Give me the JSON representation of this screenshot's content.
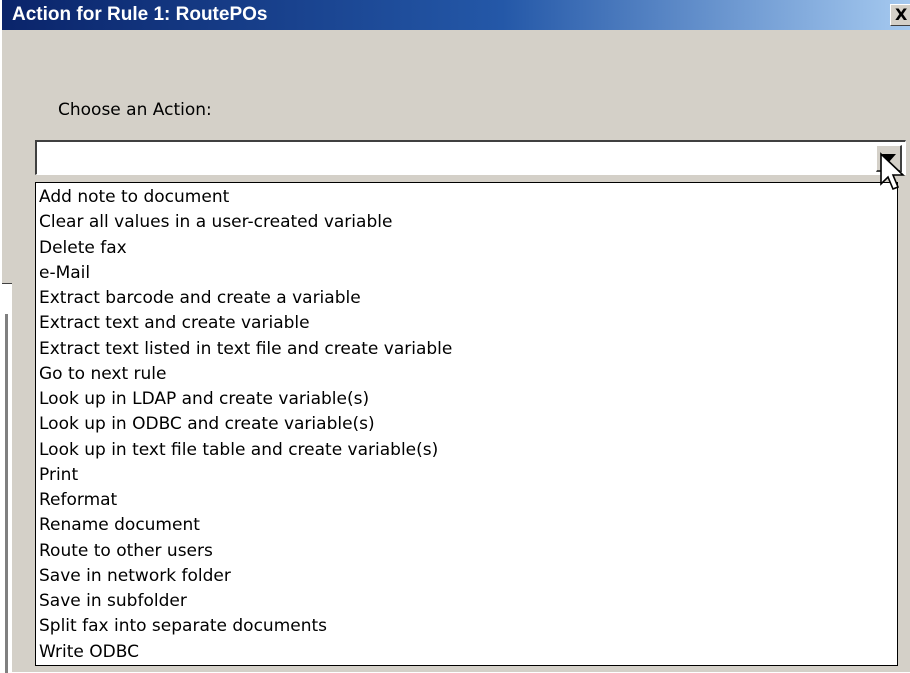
{
  "window": {
    "title": "Action for Rule 1: RoutePOs",
    "close_glyph": "X"
  },
  "form": {
    "label": "Choose an Action:",
    "selected_value": ""
  },
  "dropdown": {
    "options": [
      "Add note to document",
      "Clear all values in a user-created variable",
      "Delete fax",
      "e-Mail",
      "Extract barcode and create a variable",
      "Extract text and create variable",
      "Extract text listed in text file and create variable",
      "Go to next rule",
      "Look up in LDAP and create variable(s)",
      "Look up in ODBC and create variable(s)",
      "Look up in text file table and create variable(s)",
      "Print",
      "Reformat",
      "Rename document",
      "Route to other users",
      "Save in network folder",
      "Save in subfolder",
      "Split fax into separate documents",
      "Write ODBC"
    ]
  },
  "icons": {
    "dropdown_button": "chevron-down-icon",
    "pointer": "mouse-pointer-icon",
    "close": "close-icon"
  },
  "colors": {
    "titlebar_start": "#0a246a",
    "titlebar_end": "#a6caf0",
    "dialog_face": "#d4d0c8"
  }
}
